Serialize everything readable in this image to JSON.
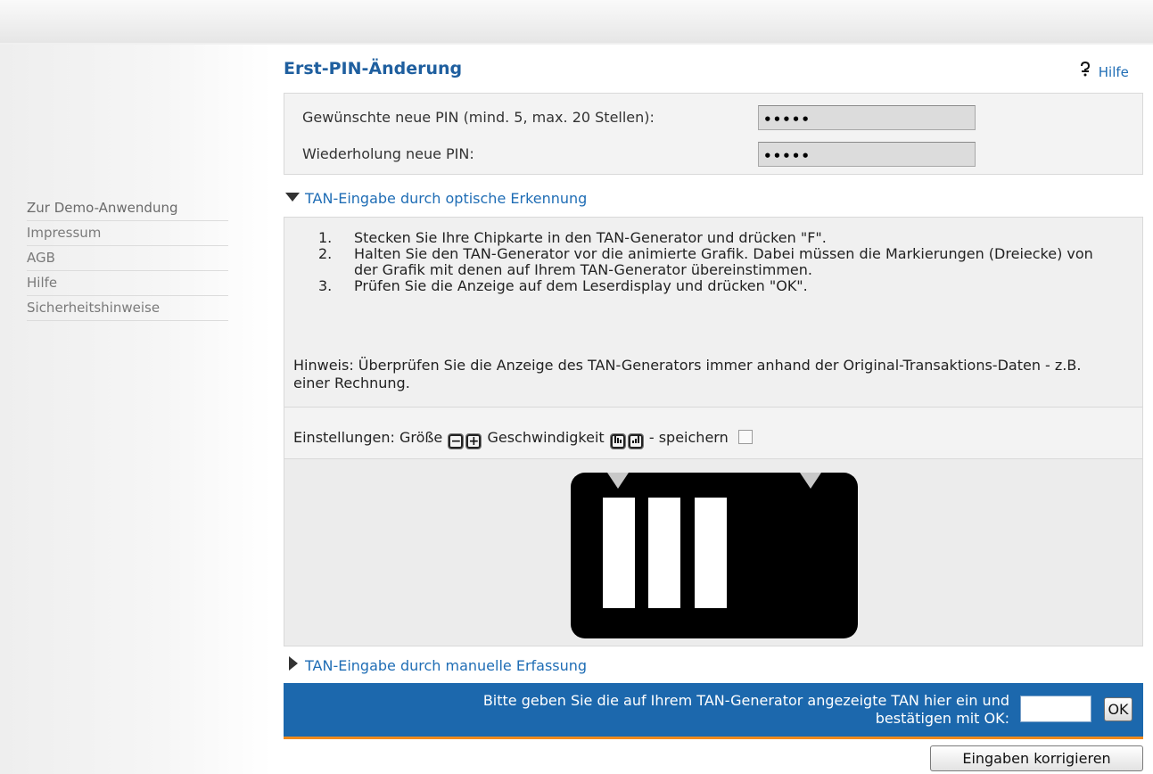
{
  "page": {
    "title": "Erst-PIN-Änderung",
    "help_label": "Hilfe",
    "help_icon": "question-icon"
  },
  "sidebar": {
    "items": [
      {
        "label": "Zur Demo-Anwendung"
      },
      {
        "label": "Impressum"
      },
      {
        "label": "AGB"
      },
      {
        "label": "Hilfe"
      },
      {
        "label": "Sicherheitshinweise"
      }
    ]
  },
  "pin_form": {
    "new_pin_label": "Gewünschte neue PIN (mind. 5, max. 20 Stellen):",
    "new_pin_value": "•••••",
    "repeat_pin_label": "Wiederholung neue PIN:",
    "repeat_pin_value": "•••••"
  },
  "optical": {
    "section_label": "TAN-Eingabe durch optische Erkennung",
    "expanded": true,
    "steps": [
      {
        "num": "1.",
        "text": "Stecken Sie Ihre Chipkarte in den TAN-Generator und drücken \"F\"."
      },
      {
        "num": "2.",
        "text": "Halten Sie den TAN-Generator vor die animierte Grafik. Dabei müssen die Markierungen (Dreiecke) von der Grafik mit denen auf Ihrem TAN-Generator übereinstimmen."
      },
      {
        "num": "3.",
        "text": "Prüfen Sie die Anzeige auf dem Leserdisplay und drücken \"OK\"."
      }
    ],
    "note": "Hinweis: Überprüfen Sie die Anzeige des TAN-Generators immer anhand der Original-Transaktions-Daten - z.B. einer Rechnung."
  },
  "settings": {
    "label": "Einstellungen: Größe",
    "size_minus": "−",
    "size_plus": "+",
    "speed_label": "Geschwindigkeit",
    "speed_slower_icon": "speed-slower-icon",
    "speed_faster_icon": "speed-faster-icon",
    "save_label": "- speichern",
    "save_checked": false
  },
  "manual": {
    "section_label": "TAN-Eingabe durch manuelle Erfassung",
    "expanded": false
  },
  "tan_entry": {
    "prompt_line1": "Bitte geben Sie die auf Ihrem TAN-Generator angezeigte TAN hier ein und",
    "prompt_line2": "bestätigen mit OK:",
    "value": "",
    "ok_label": "OK"
  },
  "actions": {
    "correct_label": "Eingaben korrigieren"
  },
  "colors": {
    "accent": "#1c68ad",
    "link": "#1f6db5",
    "divider": "#f08a1d"
  }
}
